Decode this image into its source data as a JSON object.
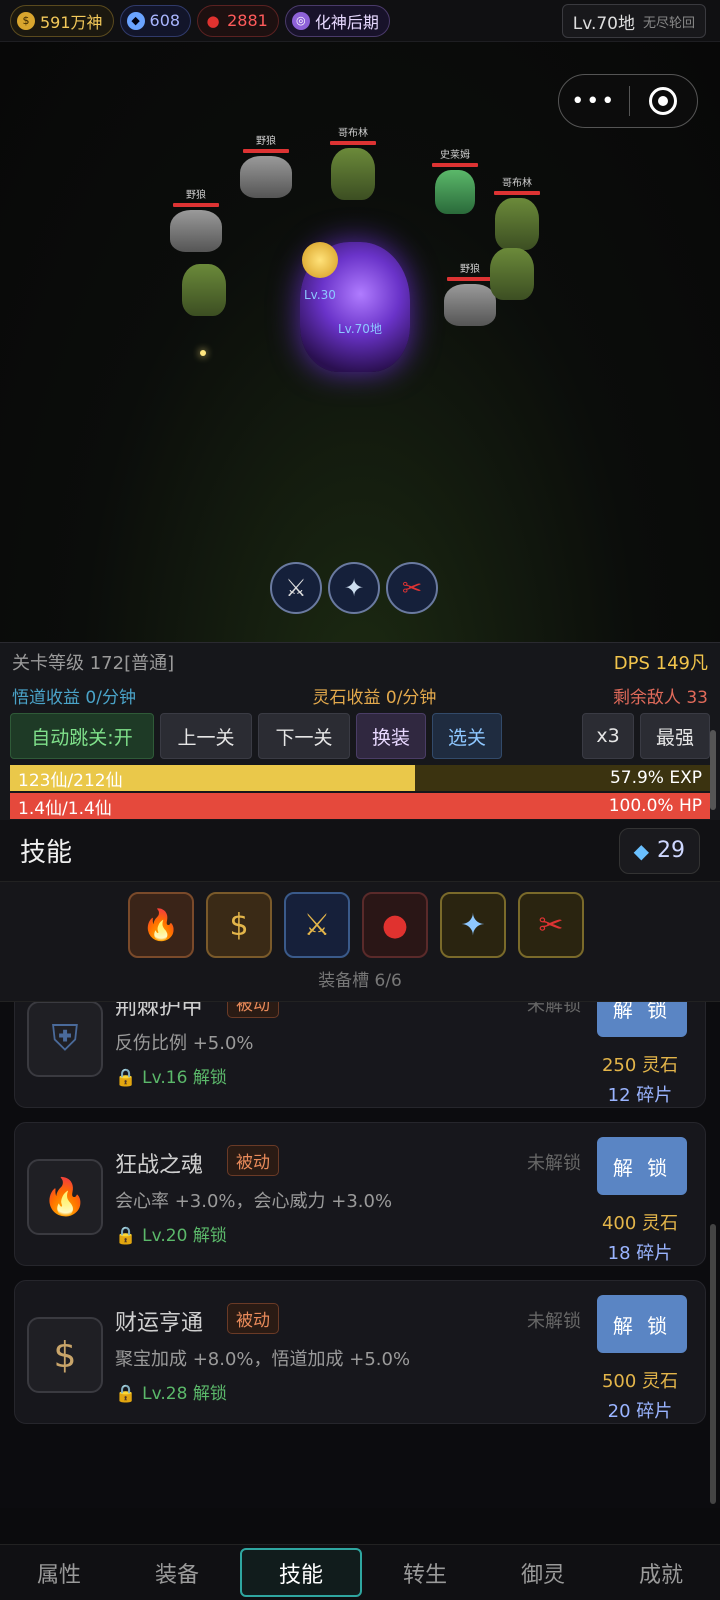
{
  "resources": {
    "gold": "591万神",
    "gems": "608",
    "blood": "2881",
    "realm": "化神后期"
  },
  "level_box": {
    "main": "Lv.70地",
    "sub": "无尽轮回"
  },
  "capsule": {
    "more": "•••"
  },
  "battle": {
    "enemies": [
      {
        "name": "野狼",
        "type": "wolf"
      },
      {
        "name": "哥布林",
        "type": "goblin"
      },
      {
        "name": "史莱姆",
        "type": "slime"
      },
      {
        "name": "哥布林",
        "type": "goblin"
      },
      {
        "name": "野狼",
        "type": "wolf"
      },
      {
        "name": "野狼",
        "type": "wolf"
      },
      {
        "name": "哥布林",
        "type": "goblin"
      },
      {
        "name": "野狼",
        "type": "wolf"
      }
    ],
    "pet_level": "Lv.30",
    "hero_level": "Lv.70地",
    "active_skills": [
      "sword-skill-icon",
      "lightning-skill-icon",
      "blade-skill-icon"
    ]
  },
  "stage": {
    "label": "关卡等级 172[普通]",
    "dps": "DPS 149凡",
    "insight_income": "悟道收益 0/分钟",
    "stone_income": "灵石收益 0/分钟",
    "enemies_left": "剩余敌人 33"
  },
  "controls": {
    "auto": "自动跳关:开",
    "prev": "上一关",
    "next": "下一关",
    "swap": "换装",
    "pick": "选关",
    "speed": "x3",
    "best": "最强"
  },
  "exp": {
    "text": "123仙/212仙",
    "percent_text": "57.9% EXP",
    "fraction": 0.579
  },
  "hp": {
    "text": "1.4仙/1.4仙",
    "percent_text": "100.0% HP",
    "fraction": 1.0
  },
  "skills_panel": {
    "title": "技能",
    "gems": "29",
    "equip_caption": "装备槽 6/6",
    "equipped": [
      "fire-icon",
      "money-bag-icon",
      "sword-skill-icon",
      "blood-drop-icon",
      "lightning-skill-icon",
      "blade-skill-icon"
    ]
  },
  "skill_cards": [
    {
      "name": "荆棘护甲",
      "tag": "被动",
      "desc": "反伤比例 +5.0%",
      "unlock": "Lv.16 解锁",
      "status": "未解锁",
      "button": "解 锁",
      "cost_stone": "250 灵石",
      "cost_shard": "12 碎片",
      "icon": "shield-icon"
    },
    {
      "name": "狂战之魂",
      "tag": "被动",
      "desc": "会心率 +3.0%，会心威力 +3.0%",
      "unlock": "Lv.20 解锁",
      "status": "未解锁",
      "button": "解 锁",
      "cost_stone": "400 灵石",
      "cost_shard": "18 碎片",
      "icon": "fire-icon"
    },
    {
      "name": "财运亨通",
      "tag": "被动",
      "desc": "聚宝加成 +8.0%，悟道加成 +5.0%",
      "unlock": "Lv.28 解锁",
      "status": "未解锁",
      "button": "解 锁",
      "cost_stone": "500 灵石",
      "cost_shard": "20 碎片",
      "icon": "money-bag-icon"
    }
  ],
  "nav": [
    "属性",
    "装备",
    "技能",
    "转生",
    "御灵",
    "成就"
  ],
  "nav_active": 2
}
